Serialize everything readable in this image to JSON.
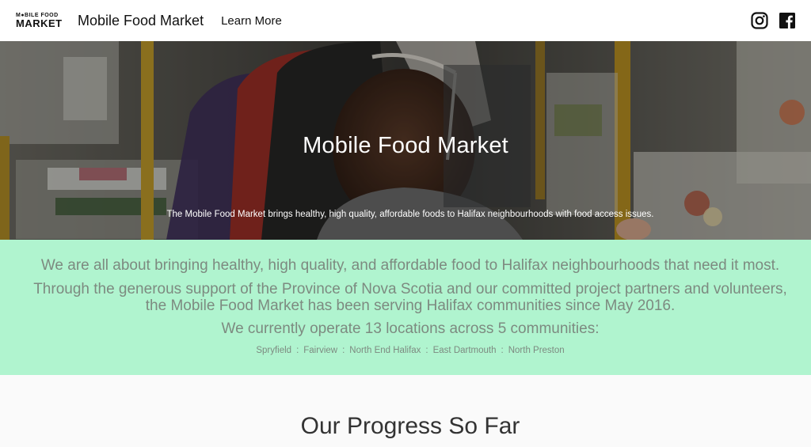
{
  "nav": {
    "logo_top": "M●BILE FOOD",
    "logo_bottom": "MARKET",
    "site_title": "Mobile Food Market",
    "learn_more": "Learn More",
    "icons": [
      "instagram-icon",
      "facebook-icon"
    ]
  },
  "hero": {
    "title": "Mobile Food Market",
    "subtitle": "The Mobile Food Market brings healthy, high quality, affordable foods to Halifax neighbourhoods with food access issues."
  },
  "mission": {
    "line1": "We are all about bringing healthy, high quality, and affordable food to Halifax neighbourhoods that need it most.",
    "line2a": "Through the generous support of the Province of Nova Scotia and our committed project partners and volunteers,",
    "line2b": "the Mobile Food Market has been serving Halifax communities since May 2016.",
    "line3": "We currently operate 13 locations across 5 communities:",
    "separator": ":",
    "communities": [
      "Spryfield",
      "Fairview",
      "North End Halifax",
      "East Dartmouth",
      "North Preston"
    ]
  },
  "progress": {
    "heading": "Our Progress So Far"
  },
  "colors": {
    "mint": "#b0f4cf",
    "mint_text": "#7d8a80",
    "logo_accent": "#e84b2e"
  }
}
